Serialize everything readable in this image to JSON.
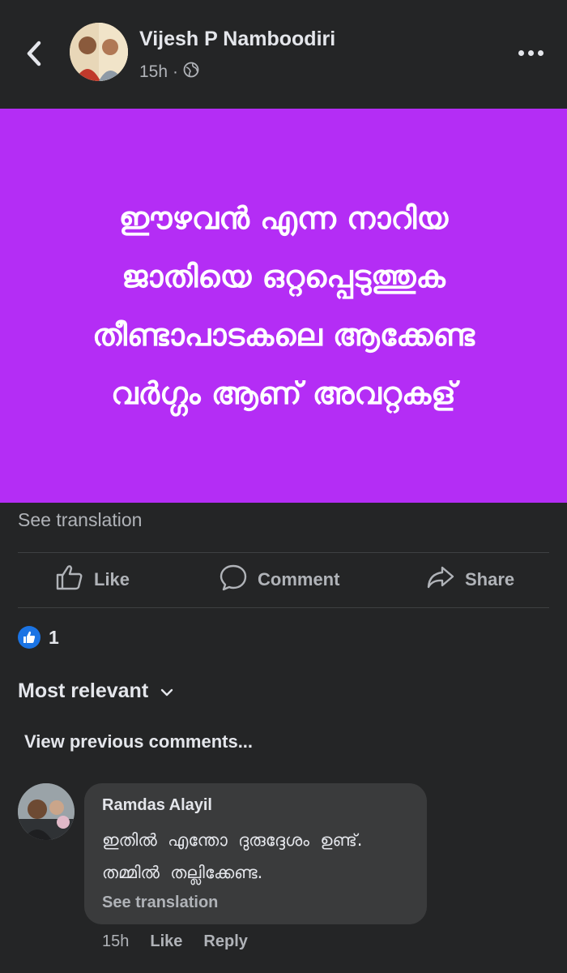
{
  "post": {
    "author": "Vijesh P Namboodiri",
    "time": "15h",
    "visibility": "globe-icon",
    "text_lines": [
      "ഈഴവൻ എന്ന നാറിയ",
      "ജാതിയെ ഒറ്റപ്പെടുത്തുക",
      "തീണ്ടാപാടകലെ ആക്കേണ്ട",
      "വർഗ്ഗം ആണ് അവറ്റകള്"
    ],
    "background_color": "#b42df5",
    "see_translation": "See translation"
  },
  "actions": {
    "like": "Like",
    "comment": "Comment",
    "share": "Share"
  },
  "reactions": {
    "count": "1"
  },
  "comments": {
    "sort_label": "Most relevant",
    "view_previous": "View previous comments...",
    "items": [
      {
        "author": "Ramdas Alayil",
        "text": "ഇതിൽ  എന്തോ  ദുരുദ്ദേശം  ഉണ്ട്.\nതമ്മിൽ  തല്ലിക്കേണ്ട.",
        "see_translation": "See translation",
        "time": "15h",
        "like": "Like",
        "reply": "Reply"
      }
    ]
  }
}
